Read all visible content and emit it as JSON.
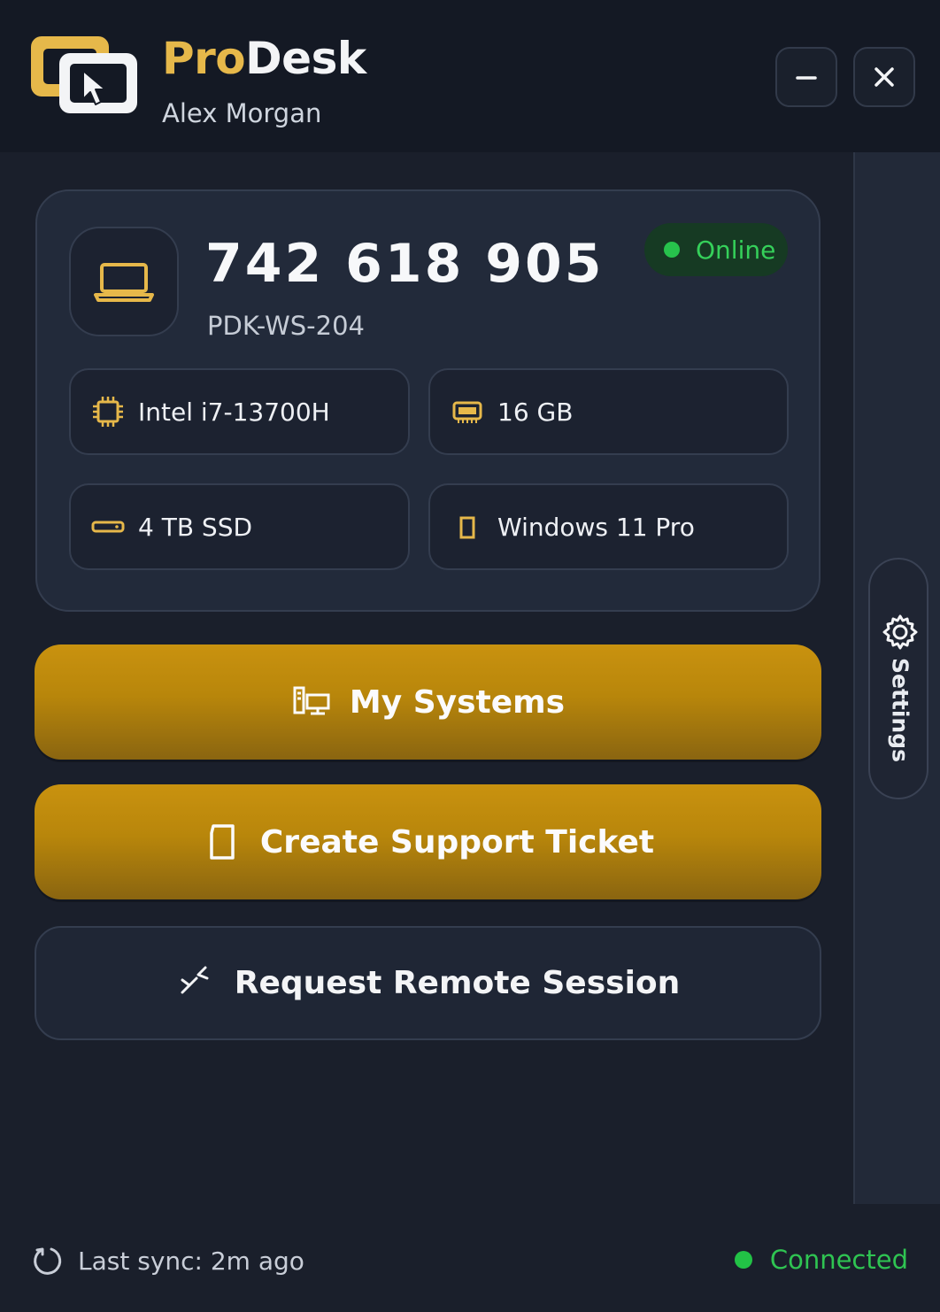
{
  "header": {
    "brand_pro": "Pro",
    "brand_desk": "Desk",
    "user_name": "Alex Morgan",
    "logo_icon": "remote-desktop-logo",
    "minimize_icon": "minimize-icon",
    "close_icon": "close-icon"
  },
  "device": {
    "id": "742 618 905",
    "name": "PDK-WS-204",
    "icon": "laptop-icon",
    "status": "Online",
    "specs": [
      {
        "icon": "cpu-icon",
        "label": "Intel i7-13700H"
      },
      {
        "icon": "memory-icon",
        "label": "16 GB"
      },
      {
        "icon": "drive-icon",
        "label": "4 TB SSD"
      },
      {
        "icon": "os-icon",
        "label": "Windows 11 Pro"
      }
    ]
  },
  "actions": {
    "my_systems": "My Systems",
    "create_ticket": "Create Support Ticket",
    "remote_session": "Request Remote Session"
  },
  "sidebar": {
    "settings_label": "Settings",
    "settings_icon": "gear-icon"
  },
  "footer": {
    "last_sync": "Last sync: 2m ago",
    "connection_status": "Connected"
  },
  "colors": {
    "accent_gold": "#c9920f",
    "brand_gold": "#e6b84a",
    "status_green": "#27c24c",
    "background": "#1a1f2b",
    "card": "#222a3a"
  }
}
